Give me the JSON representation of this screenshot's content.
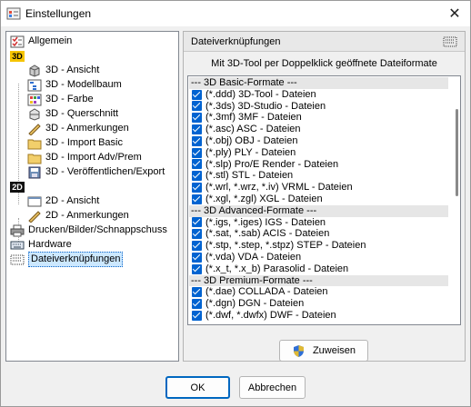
{
  "window": {
    "title": "Einstellungen"
  },
  "tree": {
    "items": [
      {
        "label": "Allgemein",
        "icon": "checklist-icon"
      },
      {
        "label": "3D",
        "icon": "3d-badge"
      },
      {
        "label": "3D - Ansicht",
        "icon": "cube-icon"
      },
      {
        "label": "3D - Modellbaum",
        "icon": "tree-icon"
      },
      {
        "label": "3D - Farbe",
        "icon": "palette-icon"
      },
      {
        "label": "3D - Querschnitt",
        "icon": "section-icon"
      },
      {
        "label": "3D - Anmerkungen",
        "icon": "pencil-icon"
      },
      {
        "label": "3D - Import Basic",
        "icon": "folder-icon"
      },
      {
        "label": "3D - Import Adv/Prem",
        "icon": "folder-icon"
      },
      {
        "label": "3D - Veröffentlichen/Export",
        "icon": "save-icon"
      },
      {
        "label": "2D",
        "icon": "2d-badge"
      },
      {
        "label": "2D - Ansicht",
        "icon": "window-icon"
      },
      {
        "label": "2D - Anmerkungen",
        "icon": "pencil-icon"
      },
      {
        "label": "Drucken/Bilder/Schnappschuss",
        "icon": "printer-icon"
      },
      {
        "label": "Hardware",
        "icon": "keyboard-icon"
      },
      {
        "label": "Dateiverknüpfungen",
        "icon": "file-assoc-icon",
        "selected": true
      }
    ]
  },
  "panel": {
    "title": "Dateiverknüpfungen",
    "subtitle": "Mit 3D-Tool per Doppelklick geöffnete Dateiformate",
    "assign_label": "Zuweisen",
    "formats": [
      {
        "type": "group",
        "label": "--- 3D Basic-Formate ---"
      },
      {
        "type": "item",
        "label": "(*.ddd) 3D-Tool - Dateien",
        "checked": true
      },
      {
        "type": "item",
        "label": "(*.3ds) 3D-Studio - Dateien",
        "checked": true
      },
      {
        "type": "item",
        "label": "(*.3mf) 3MF - Dateien",
        "checked": true
      },
      {
        "type": "item",
        "label": "(*.asc) ASC - Dateien",
        "checked": true
      },
      {
        "type": "item",
        "label": "(*.obj) OBJ - Dateien",
        "checked": true
      },
      {
        "type": "item",
        "label": "(*.ply) PLY - Dateien",
        "checked": true
      },
      {
        "type": "item",
        "label": "(*.slp) Pro/E Render - Dateien",
        "checked": true
      },
      {
        "type": "item",
        "label": "(*.stl) STL - Dateien",
        "checked": true
      },
      {
        "type": "item",
        "label": "(*.wrl, *.wrz, *.iv) VRML - Dateien",
        "checked": true
      },
      {
        "type": "item",
        "label": "(*.xgl, *.zgl) XGL - Dateien",
        "checked": true
      },
      {
        "type": "group",
        "label": "--- 3D Advanced-Formate ---"
      },
      {
        "type": "item",
        "label": "(*.igs, *.iges) IGS - Dateien",
        "checked": true
      },
      {
        "type": "item",
        "label": "(*.sat, *.sab) ACIS - Dateien",
        "checked": true
      },
      {
        "type": "item",
        "label": "(*.stp, *.step, *.stpz) STEP - Dateien",
        "checked": true
      },
      {
        "type": "item",
        "label": "(*.vda) VDA - Dateien",
        "checked": true
      },
      {
        "type": "item",
        "label": "(*.x_t, *.x_b) Parasolid - Dateien",
        "checked": true
      },
      {
        "type": "group",
        "label": "--- 3D Premium-Formate ---"
      },
      {
        "type": "item",
        "label": "(*.dae) COLLADA - Dateien",
        "checked": true
      },
      {
        "type": "item",
        "label": "(*.dgn) DGN - Dateien",
        "checked": true
      },
      {
        "type": "item",
        "label": "(*.dwf, *.dwfx) DWF - Dateien",
        "checked": true
      }
    ]
  },
  "buttons": {
    "ok": "OK",
    "cancel": "Abbrechen"
  },
  "colors": {
    "accent": "#0063d1",
    "selection": "#cce8ff"
  }
}
